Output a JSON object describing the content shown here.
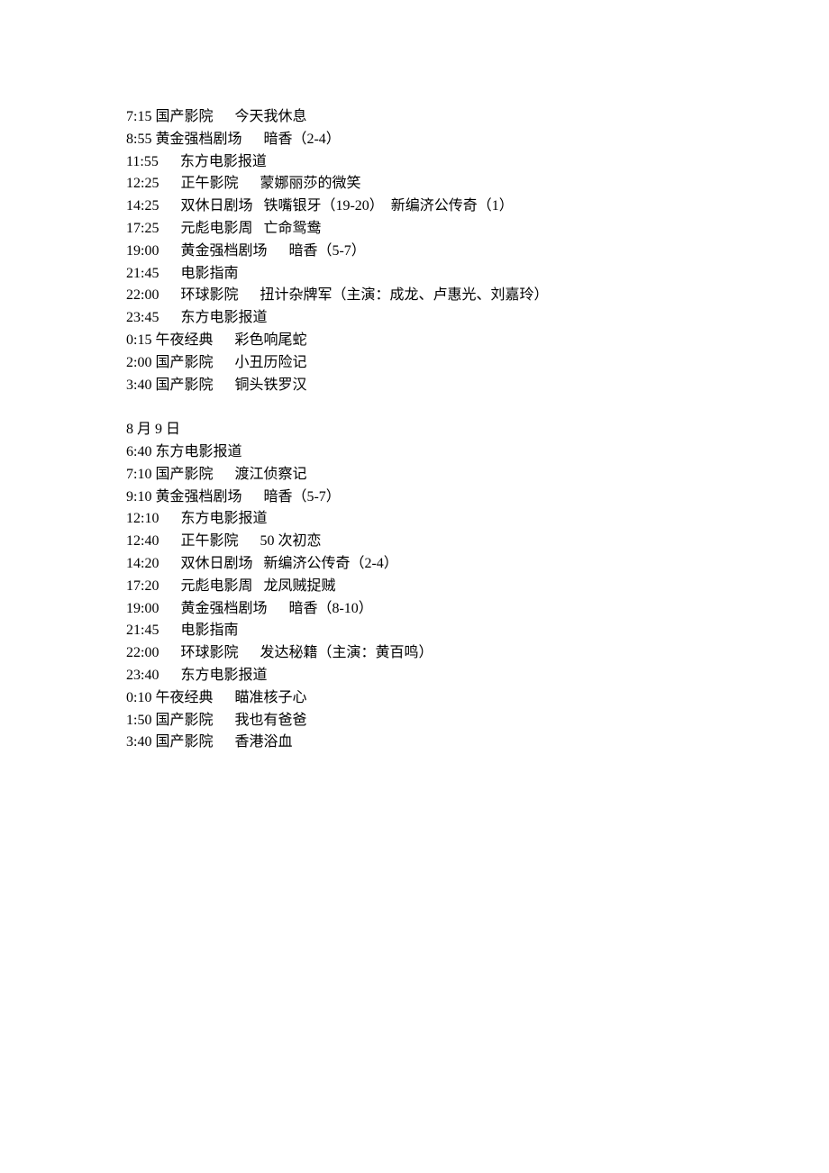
{
  "day1": {
    "rows": [
      "7:15 国产影院      今天我休息",
      "8:55 黄金强档剧场      暗香（2-4）",
      "11:55      东方电影报道",
      "12:25      正午影院      蒙娜丽莎的微笑",
      "14:25      双休日剧场   铁嘴银牙（19-20）  新编济公传奇（1）",
      "17:25      元彪电影周   亡命鸳鸯",
      "19:00      黄金强档剧场      暗香（5-7）",
      "21:45      电影指南",
      "22:00      环球影院      扭计杂牌军（主演：成龙、卢惠光、刘嘉玲）",
      "23:45      东方电影报道",
      "0:15 午夜经典      彩色响尾蛇",
      "2:00 国产影院      小丑历险记",
      "3:40 国产影院      铜头铁罗汉"
    ]
  },
  "day2": {
    "date": "8 月 9 日",
    "rows": [
      "6:40 东方电影报道",
      "7:10 国产影院      渡江侦察记",
      "9:10 黄金强档剧场      暗香（5-7）",
      "12:10      东方电影报道",
      "12:40      正午影院      50 次初恋",
      "14:20      双休日剧场   新编济公传奇（2-4）",
      "17:20      元彪电影周   龙凤贼捉贼",
      "19:00      黄金强档剧场      暗香（8-10）",
      "21:45      电影指南",
      "22:00      环球影院      发达秘籍（主演：黄百鸣）",
      "23:40      东方电影报道",
      "0:10 午夜经典      瞄准核子心",
      "1:50 国产影院      我也有爸爸",
      "3:40 国产影院      香港浴血"
    ]
  }
}
